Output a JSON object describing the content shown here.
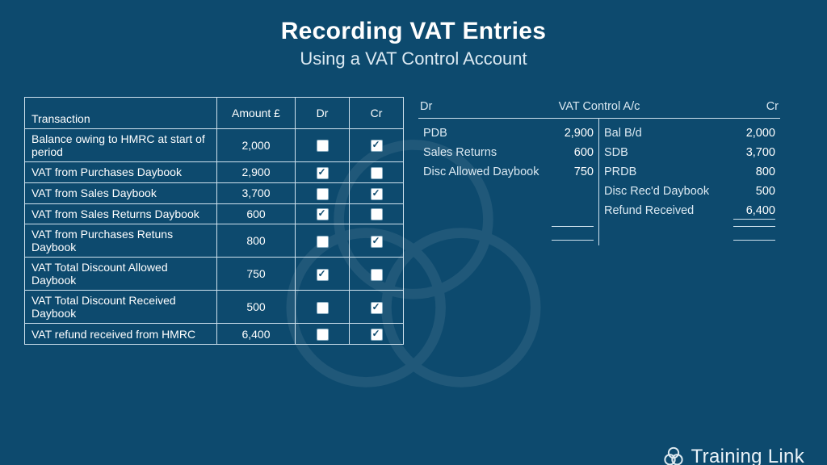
{
  "header": {
    "title": "Recording VAT Entries",
    "subtitle": "Using a VAT Control Account"
  },
  "table": {
    "headers": {
      "transaction": "Transaction",
      "amount": "Amount £",
      "dr": "Dr",
      "cr": "Cr"
    },
    "rows": [
      {
        "transaction": "Balance owing to HMRC at start of period",
        "amount": "2,000",
        "dr": false,
        "cr": true
      },
      {
        "transaction": "VAT from Purchases Daybook",
        "amount": "2,900",
        "dr": true,
        "cr": false
      },
      {
        "transaction": "VAT from Sales Daybook",
        "amount": "3,700",
        "dr": false,
        "cr": true
      },
      {
        "transaction": "VAT from Sales Returns Daybook",
        "amount": "600",
        "dr": true,
        "cr": false
      },
      {
        "transaction": "VAT from Purchases Retuns Daybook",
        "amount": "800",
        "dr": false,
        "cr": true
      },
      {
        "transaction": "VAT Total Discount Allowed Daybook",
        "amount": "750",
        "dr": true,
        "cr": false
      },
      {
        "transaction": "VAT Total Discount Received Daybook",
        "amount": "500",
        "dr": false,
        "cr": true
      },
      {
        "transaction": "VAT refund received from HMRC",
        "amount": "6,400",
        "dr": false,
        "cr": true
      }
    ]
  },
  "taccount": {
    "dr_label": "Dr",
    "cr_label": "Cr",
    "title": "VAT Control A/c",
    "debit": [
      {
        "label": "PDB",
        "value": "2,900"
      },
      {
        "label": "Sales Returns",
        "value": "600"
      },
      {
        "label": "Disc Allowed Daybook",
        "value": "750"
      }
    ],
    "credit": [
      {
        "label": "Bal B/d",
        "value": "2,000"
      },
      {
        "label": "SDB",
        "value": "3,700"
      },
      {
        "label": "PRDB",
        "value": "800"
      },
      {
        "label": "Disc Rec'd Daybook",
        "value": "500"
      },
      {
        "label": "Refund Received",
        "value": "6,400"
      }
    ]
  },
  "footer": {
    "brand": "Training Link"
  }
}
